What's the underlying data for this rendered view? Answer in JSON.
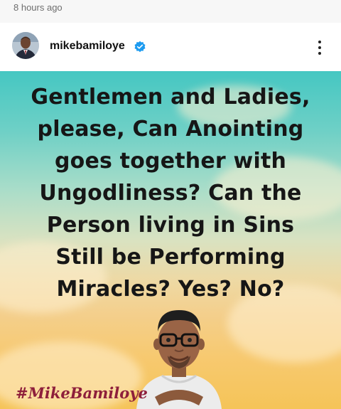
{
  "post": {
    "timestamp": "8 hours ago",
    "username": "mikebamiloye",
    "verified": true,
    "quote_lines": [
      "Gentlemen and Ladies,",
      "please, Can Anointing",
      "goes together with",
      "Ungodliness? Can the",
      "Person living in Sins",
      "Still be Performing",
      "Miracles? Yes? No?"
    ],
    "hashtag": "#MikeBamiloye"
  },
  "icons": {
    "verified": "verified-badge-icon",
    "more": "more-options-icon"
  },
  "colors": {
    "verified": "#1d9bf0",
    "hashtag": "#8e1f3b",
    "sky_top": "#45c7c2",
    "sky_bottom": "#f5c458"
  }
}
